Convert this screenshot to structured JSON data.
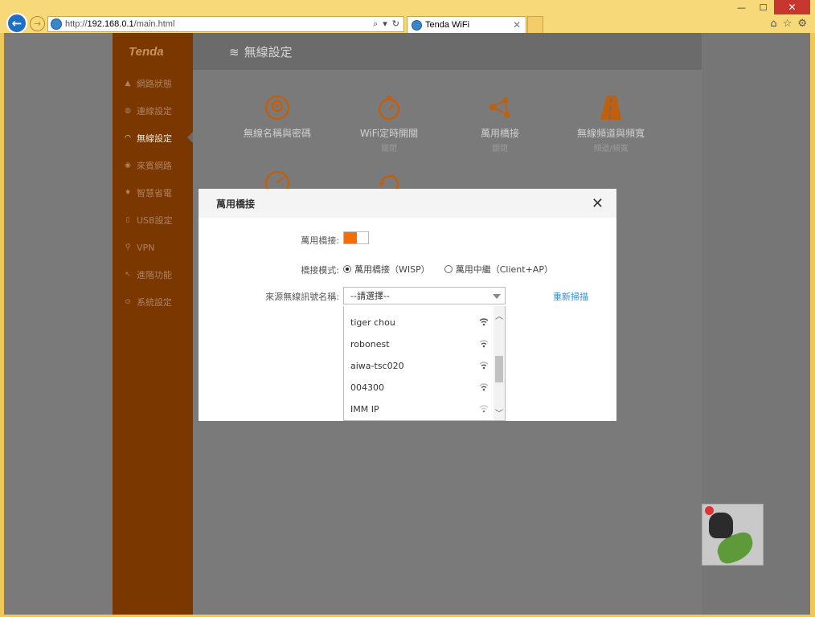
{
  "browser": {
    "url_prefix": "http://",
    "url_host": "192.168.0.1",
    "url_path": "/main.html",
    "tab_title": "Tenda WiFi",
    "window_controls": [
      "—",
      "☐",
      "✕"
    ]
  },
  "sidebar": {
    "logo": "Tenda",
    "items": [
      {
        "label": "網路狀態",
        "icon": "network-status-icon"
      },
      {
        "label": "連線設定",
        "icon": "globe-icon"
      },
      {
        "label": "無線設定",
        "icon": "wifi-icon",
        "active": true
      },
      {
        "label": "來賓網路",
        "icon": "guest-network-icon"
      },
      {
        "label": "智慧省電",
        "icon": "power-save-icon"
      },
      {
        "label": "USB設定",
        "icon": "usb-icon"
      },
      {
        "label": "VPN",
        "icon": "vpn-icon"
      },
      {
        "label": "進階功能",
        "icon": "advanced-icon"
      },
      {
        "label": "系統設定",
        "icon": "system-settings-icon"
      }
    ]
  },
  "content": {
    "title": "無線設定",
    "features": [
      {
        "label": "無線名稱與密碼",
        "sub": ""
      },
      {
        "label": "WiFi定時開關",
        "sub": "關閉"
      },
      {
        "label": "萬用橋接",
        "sub": "關閉"
      },
      {
        "label": "無線頻道與頻寬",
        "sub": "頻道/頻寬"
      }
    ]
  },
  "modal": {
    "title": "萬用橋接",
    "close": "✕",
    "bridge_label": "萬用橋接:",
    "bridge_enabled": true,
    "mode_label": "橋接模式:",
    "mode_options": [
      {
        "label": "萬用橋接（WISP）",
        "selected": true
      },
      {
        "label": "萬用中繼（Client+AP）",
        "selected": false
      }
    ],
    "ssid_label": "來源無線訊號名稱:",
    "ssid_placeholder": "--請選擇--",
    "rescan": "重新掃描",
    "networks": [
      "tiger chou",
      "robonest",
      "aiwa-tsc020",
      "004300",
      "IMM IP"
    ]
  },
  "colors": {
    "accent": "#f36d0a",
    "sidebar": "#7a3800",
    "link": "#2a8fd6",
    "overlay": "#7a7a7a"
  }
}
